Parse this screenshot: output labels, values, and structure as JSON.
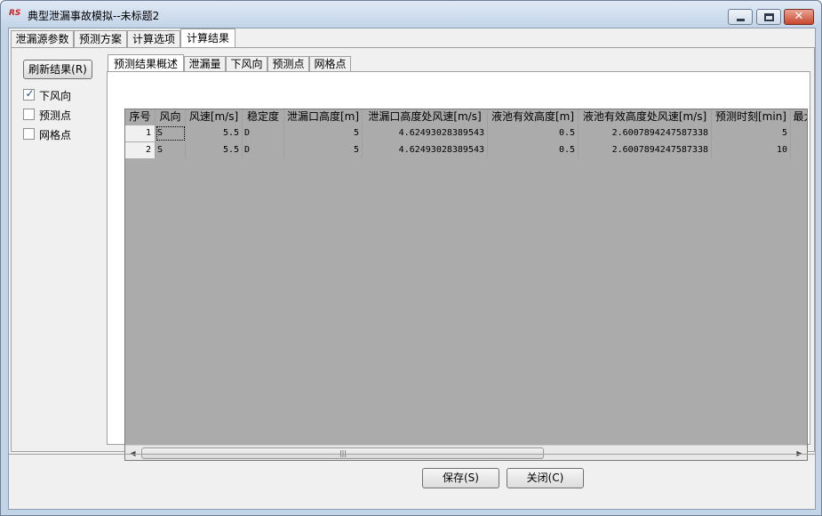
{
  "window": {
    "title": "典型泄漏事故模拟--未标题2",
    "app_icon_text": "RS"
  },
  "top_tabs": [
    "泄漏源参数",
    "预测方案",
    "计算选项",
    "计算结果"
  ],
  "active_top_tab": 3,
  "left_panel": {
    "refresh_button": "刷新结果(R)",
    "checkboxes": [
      {
        "label": "下风向",
        "checked": true
      },
      {
        "label": "预测点",
        "checked": false
      },
      {
        "label": "网格点",
        "checked": false
      }
    ]
  },
  "inner_tabs": [
    "预测结果概述",
    "泄漏量",
    "下风向",
    "预测点",
    "网格点"
  ],
  "active_inner_tab": 0,
  "grid": {
    "columns": [
      "序号",
      "风向",
      "风速[m/s]",
      "稳定度",
      "泄漏口高度[m]",
      "泄漏口高度处风速[m/s]",
      "液池有效高度[m]",
      "液池有效高度处风速[m/s]",
      "预测时刻[min]",
      "最大"
    ],
    "rows": [
      [
        "1",
        "S",
        "5.5",
        "D",
        "5",
        "4.62493028389543",
        "0.5",
        "2.6007894247587338",
        "5",
        ""
      ],
      [
        "2",
        "S",
        "5.5",
        "D",
        "5",
        "4.62493028389543",
        "0.5",
        "2.6007894247587338",
        "10",
        ""
      ]
    ]
  },
  "buttons": {
    "save": "保存(S)",
    "close": "关闭(C)"
  },
  "colors": {
    "grid_background": "#ababab",
    "frame": "#c3d4e8",
    "close_button": "#c7472d"
  }
}
